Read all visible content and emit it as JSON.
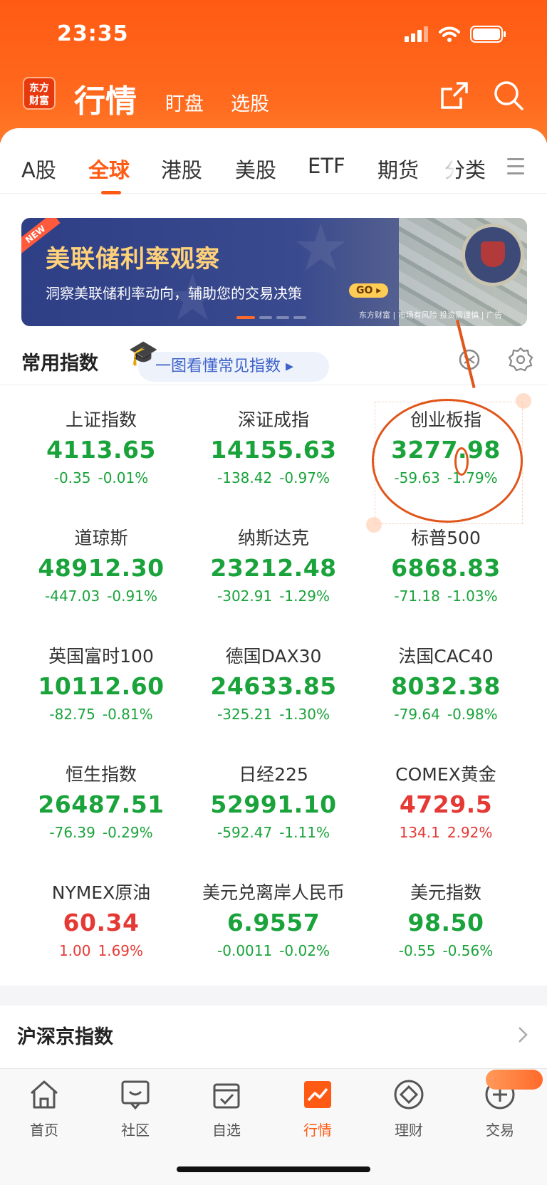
{
  "status": {
    "time": "23:35"
  },
  "header": {
    "logo_text": "东方\n财富",
    "title": "行情",
    "sub1": "盯盘",
    "sub2": "选股"
  },
  "tabs": [
    "A股",
    "全球",
    "港股",
    "美股",
    "ETF",
    "期货",
    "分类"
  ],
  "active_tab": "全球",
  "banner": {
    "badge": "NEW",
    "title": "美联储利率观察",
    "subtitle": "洞察美联储利率动向，辅助您的交易决策",
    "go": "GO",
    "footer": "东方财富 | 市场有风险 投资需谨慎 | 广告"
  },
  "section": {
    "title": "常用指数",
    "guide": "一图看懂常见指数 ▸"
  },
  "indices": [
    {
      "name": "上证指数",
      "price": "4113.65",
      "change": "-0.35",
      "pct": "-0.01%",
      "color": "#1aa33b"
    },
    {
      "name": "深证成指",
      "price": "14155.63",
      "change": "-138.42",
      "pct": "-0.97%",
      "color": "#1aa33b"
    },
    {
      "name": "创业板指",
      "price": "3277.98",
      "change": "-59.63",
      "pct": "-1.79%",
      "color": "#1aa33b"
    },
    {
      "name": "道琼斯",
      "price": "48912.30",
      "change": "-447.03",
      "pct": "-0.91%",
      "color": "#1aa33b"
    },
    {
      "name": "纳斯达克",
      "price": "23212.48",
      "change": "-302.91",
      "pct": "-1.29%",
      "color": "#1aa33b"
    },
    {
      "name": "标普500",
      "price": "6868.83",
      "change": "-71.18",
      "pct": "-1.03%",
      "color": "#1aa33b"
    },
    {
      "name": "英国富时100",
      "price": "10112.60",
      "change": "-82.75",
      "pct": "-0.81%",
      "color": "#1aa33b"
    },
    {
      "name": "德国DAX30",
      "price": "24633.85",
      "change": "-325.21",
      "pct": "-1.30%",
      "color": "#1aa33b"
    },
    {
      "name": "法国CAC40",
      "price": "8032.38",
      "change": "-79.64",
      "pct": "-0.98%",
      "color": "#1aa33b"
    },
    {
      "name": "恒生指数",
      "price": "26487.51",
      "change": "-76.39",
      "pct": "-0.29%",
      "color": "#1aa33b"
    },
    {
      "name": "日经225",
      "price": "52991.10",
      "change": "-592.47",
      "pct": "-1.11%",
      "color": "#1aa33b"
    },
    {
      "name": "COMEX黄金",
      "price": "4729.5",
      "change": "134.1",
      "pct": "2.92%",
      "color": "#e53935"
    },
    {
      "name": "NYMEX原油",
      "price": "60.34",
      "change": "1.00",
      "pct": "1.69%",
      "color": "#e53935"
    },
    {
      "name": "美元兑离岸人民币",
      "price": "6.9557",
      "change": "-0.0011",
      "pct": "-0.02%",
      "color": "#1aa33b"
    },
    {
      "name": "美元指数",
      "price": "98.50",
      "change": "-0.55",
      "pct": "-0.56%",
      "color": "#1aa33b"
    }
  ],
  "hs_section": {
    "title": "沪深京指数"
  },
  "tabbar": [
    {
      "label": "首页",
      "icon": "home-icon"
    },
    {
      "label": "社区",
      "icon": "community-icon"
    },
    {
      "label": "自选",
      "icon": "watchlist-icon"
    },
    {
      "label": "行情",
      "icon": "market-icon"
    },
    {
      "label": "理财",
      "icon": "wealth-icon"
    },
    {
      "label": "交易",
      "icon": "trade-icon"
    }
  ],
  "colors": {
    "brand": "#ff5a14",
    "up": "#e53935",
    "down": "#1aa33b"
  }
}
